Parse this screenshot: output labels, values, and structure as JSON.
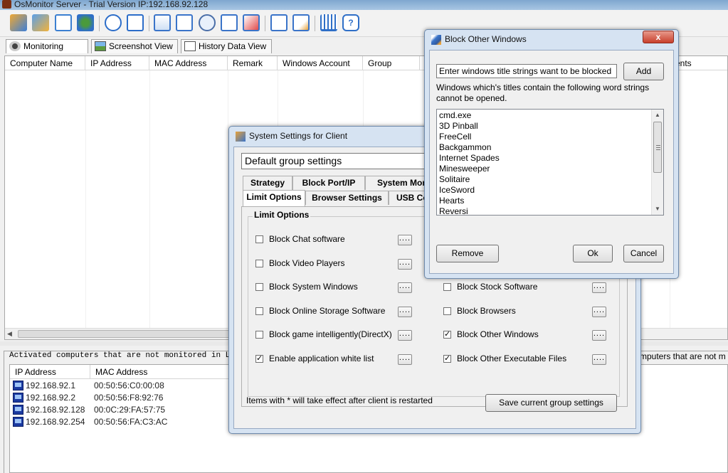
{
  "main_window": {
    "title": "OsMonitor Server - Trial Version IP:192.168.92.128"
  },
  "toolbar": {
    "icons": [
      "settings-icon",
      "monitor-settings-icon",
      "file-icon",
      "network-icon",
      "group-icon",
      "lock-icon",
      "remote-icon",
      "rss-icon",
      "search-icon",
      "copy-icon",
      "chart-icon",
      "ip-icon",
      "alert-icon",
      "cart-icon",
      "help-icon"
    ]
  },
  "view_tabs": [
    {
      "label": "Monitoring View"
    },
    {
      "label": "Screenshot View"
    },
    {
      "label": "History Data View"
    }
  ],
  "upper_list": {
    "columns": [
      "Computer Name",
      "IP Address",
      "MAC Address",
      "Remark",
      "Windows Account",
      "Group"
    ],
    "right_column_fragment": "vents"
  },
  "lower_area": {
    "caption": "Activated computers that are not monitored in LAN (",
    "caption_right": "mputers that are not m",
    "columns": [
      "IP Address",
      "MAC Address"
    ],
    "rows": [
      {
        "ip": "192.168.92.1",
        "mac": "00:50:56:C0:00:08"
      },
      {
        "ip": "192.168.92.2",
        "mac": "00:50:56:F8:92:76"
      },
      {
        "ip": "192.168.92.128",
        "mac": "00:0C:29:FA:57:75"
      },
      {
        "ip": "192.168.92.254",
        "mac": "00:50:56:FA:C3:AC"
      }
    ]
  },
  "system_settings": {
    "title": "System Settings for Client",
    "group_combo": "Default group settings",
    "tabs_row1": [
      "Strategy",
      "Block Port/IP",
      "System Mon"
    ],
    "tabs_row2": [
      "Limit Options",
      "Browser Settings",
      "USB Co"
    ],
    "group_caption": "Limit Options",
    "options_left": [
      {
        "label": "Block Chat software",
        "checked": false
      },
      {
        "label": "Block Video Players",
        "checked": false
      },
      {
        "label": "Block System Windows",
        "checked": false
      },
      {
        "label": "Block Online Storage Software",
        "checked": false
      },
      {
        "label": "Block game intelligently(DirectX)",
        "checked": false
      },
      {
        "label": "Enable application white list",
        "checked": true
      }
    ],
    "options_right": [
      {
        "label": "Block Stock Software",
        "checked": false
      },
      {
        "label": "Block Browsers",
        "checked": false
      },
      {
        "label": "Block Other Windows",
        "checked": true
      },
      {
        "label": "Block Other Executable Files",
        "checked": true
      }
    ],
    "dots_label": "....",
    "footer_note": "Items with * will take effect after client is restarted",
    "save_button": "Save current group settings"
  },
  "block_windows": {
    "title": "Block Other Windows",
    "input_value": "Enter windows title strings want to be blocked",
    "add_button": "Add",
    "description": "Windows which's titles contain the following word strings cannot be opened.",
    "items": [
      "cmd.exe",
      "3D Pinball",
      "FreeCell",
      "Backgammon",
      "Internet Spades",
      "Minesweeper",
      "Solitaire",
      "IceSword",
      "Hearts",
      "Reversi"
    ],
    "remove_button": "Remove",
    "ok_button": "Ok",
    "cancel_button": "Cancel",
    "close_glyph": "x"
  }
}
